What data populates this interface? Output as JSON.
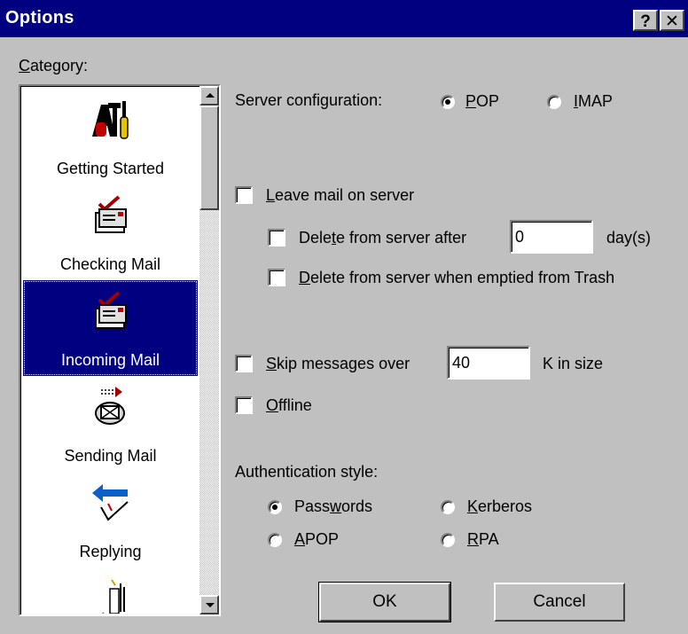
{
  "window": {
    "title": "Options",
    "help_label": "?",
    "close_label": "✕"
  },
  "category_label": {
    "mnemonic": "C",
    "rest": "ategory:"
  },
  "categories": [
    {
      "label": "Getting Started",
      "icon": "tools-icon"
    },
    {
      "label": "Checking Mail",
      "icon": "checking-mail-icon"
    },
    {
      "label": "Incoming Mail",
      "icon": "incoming-mail-icon",
      "selected": true
    },
    {
      "label": "Sending Mail",
      "icon": "sending-mail-icon"
    },
    {
      "label": "Replying",
      "icon": "replying-icon"
    },
    {
      "label": "",
      "icon": "attachments-icon"
    }
  ],
  "server": {
    "label": "Server configuration:",
    "pop": {
      "mnemonic": "P",
      "rest": "OP",
      "checked": true
    },
    "imap": {
      "mnemonic": "I",
      "rest": "MAP",
      "checked": false
    }
  },
  "leave_mail": {
    "mnemonic": "L",
    "rest": "eave mail on server",
    "checked": false
  },
  "delete_after": {
    "before": "Dele",
    "mnemonic": "t",
    "after": "e from server after",
    "value": "0",
    "unit": "day(s)",
    "checked": false
  },
  "delete_trash": {
    "mnemonic": "D",
    "rest": "elete from server when emptied from Trash",
    "checked": false
  },
  "skip": {
    "mnemonic": "S",
    "rest": "kip messages over",
    "value": "40",
    "unit": "K in size",
    "checked": false
  },
  "offline": {
    "mnemonic": "O",
    "rest": "ffline",
    "checked": false
  },
  "auth": {
    "label": "Authentication style:",
    "passwords": {
      "before": "Pass",
      "mnemonic": "w",
      "after": "ords",
      "checked": true
    },
    "kerberos": {
      "mnemonic": "K",
      "rest": "erberos",
      "checked": false
    },
    "apop": {
      "mnemonic": "A",
      "rest": "POP",
      "checked": false
    },
    "rpa": {
      "mnemonic": "R",
      "rest": "PA",
      "checked": false
    }
  },
  "buttons": {
    "ok": "OK",
    "cancel": "Cancel"
  },
  "colors": {
    "face": "#c0c0c0",
    "titlebar": "#000080",
    "selection": "#000080"
  }
}
